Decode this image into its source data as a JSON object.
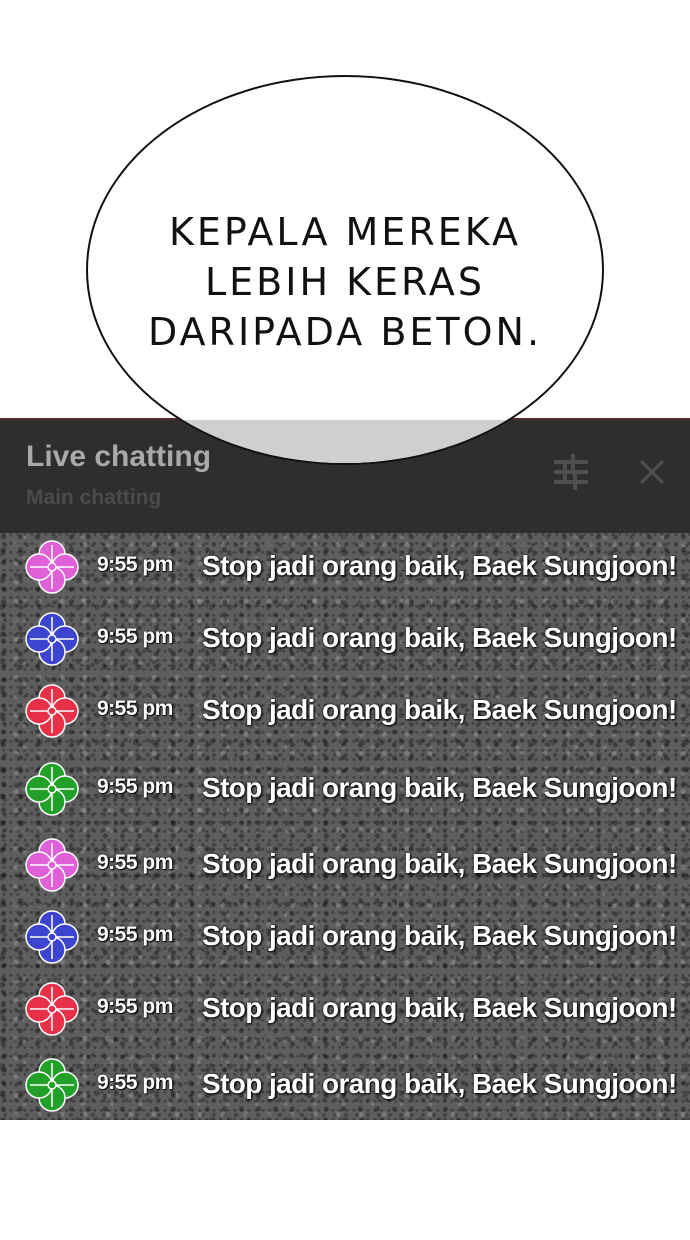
{
  "bubble": {
    "lines": [
      "KEPALA MEREKA",
      "LEBIH KERAS",
      "DARIPADA BETON."
    ]
  },
  "chat": {
    "title": "Live chatting",
    "subtitle": "Main chatting",
    "filter_icon": "filter-sliders-icon",
    "close_icon": "close-icon",
    "messages": [
      {
        "avatar_color": "#e060d8",
        "time": "9:55 pm",
        "text": "Stop jadi orang baik, Baek Sungjoon!"
      },
      {
        "avatar_color": "#3c44d0",
        "time": "9:55 pm",
        "text": "Stop jadi orang baik, Baek Sungjoon!"
      },
      {
        "avatar_color": "#e83048",
        "time": "9:55 pm",
        "text": "Stop jadi orang baik, Baek Sungjoon!"
      },
      {
        "avatar_color": "#22a02a",
        "time": "9:55 pm",
        "text": "Stop jadi orang baik, Baek Sungjoon!"
      },
      {
        "avatar_color": "#e060d8",
        "time": "9:55 pm",
        "text": "Stop jadi orang baik, Baek Sungjoon!"
      },
      {
        "avatar_color": "#3c44d0",
        "time": "9:55 pm",
        "text": "Stop jadi orang baik, Baek Sungjoon!"
      },
      {
        "avatar_color": "#e83048",
        "time": "9:55 pm",
        "text": "Stop jadi orang baik, Baek Sungjoon!"
      },
      {
        "avatar_color": "#22a02a",
        "time": "9:55 pm",
        "text": "Stop jadi orang baik, Baek Sungjoon!"
      }
    ]
  }
}
